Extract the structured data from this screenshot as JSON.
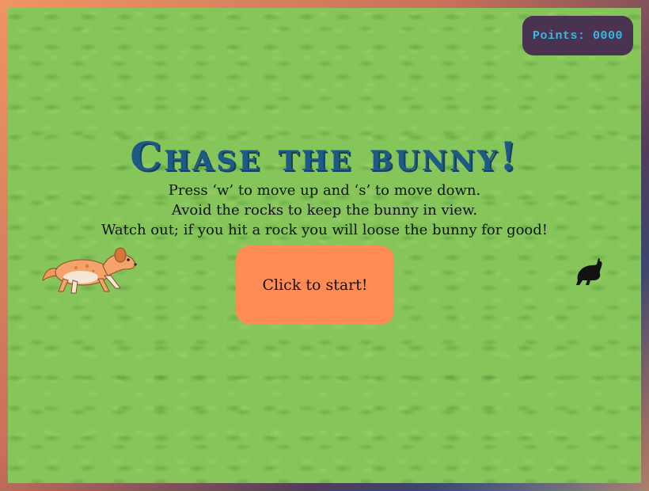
{
  "score": {
    "label": "Points: 0000",
    "points": 0
  },
  "title": "Chase the bunny!",
  "instructions": [
    "Press ‘w’ to move up and ‘s’ to move down.",
    "Avoid the rocks to keep the bunny in view.",
    "Watch out; if you hit a rock you will loose the bunny for good!"
  ],
  "start_button": {
    "label": "Click to start!"
  },
  "characters": {
    "dog_icon": "dog-sprite",
    "bunny_icon": "bunny-silhouette"
  },
  "colors": {
    "grass": "#86c55a",
    "title": "#1e5a86",
    "start_button": "#ff8c55",
    "score_box": "#4a3350",
    "score_text": "#37b9e6"
  }
}
